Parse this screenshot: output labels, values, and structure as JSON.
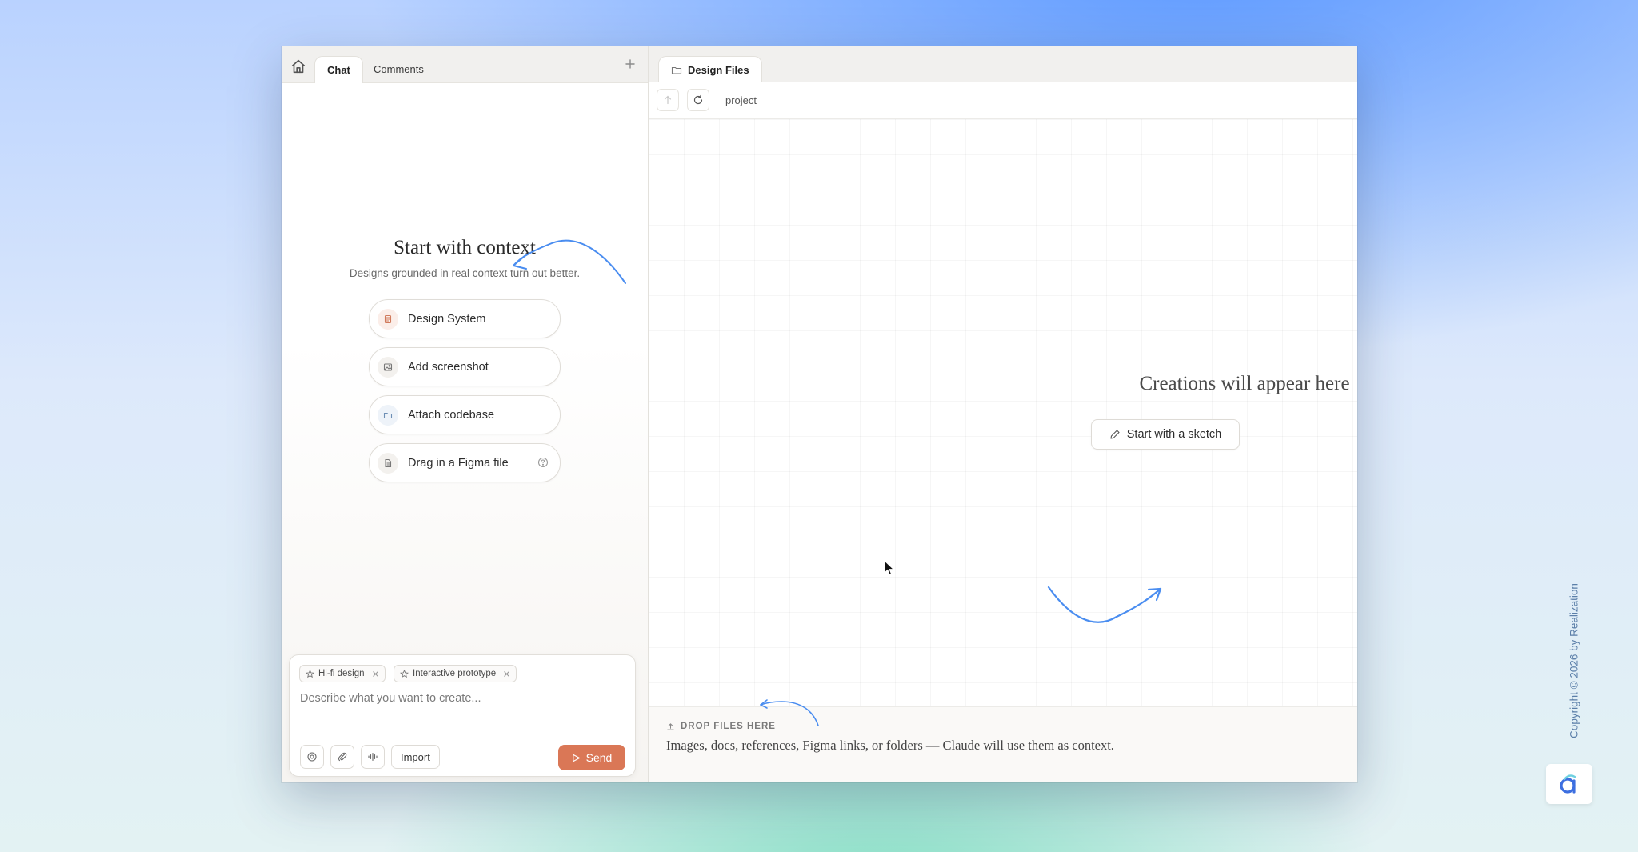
{
  "left_panel": {
    "tabs": [
      {
        "label": "Chat",
        "active": true
      },
      {
        "label": "Comments",
        "active": false
      }
    ],
    "context": {
      "title": "Start with context",
      "subtitle": "Designs grounded in real context turn out better.",
      "options": [
        {
          "label": "Design System",
          "icon": "design-system-icon"
        },
        {
          "label": "Add screenshot",
          "icon": "image-icon"
        },
        {
          "label": "Attach codebase",
          "icon": "folder-icon"
        },
        {
          "label": "Drag in a Figma file",
          "icon": "document-icon",
          "help_icon": "help-icon"
        }
      ]
    },
    "composer": {
      "chips": [
        {
          "label": "Hi-fi design"
        },
        {
          "label": "Interactive prototype"
        }
      ],
      "placeholder": "Describe what you want to create...",
      "import_label": "Import",
      "send_label": "Send"
    }
  },
  "right_panel": {
    "tab_label": "Design Files",
    "breadcrumb": "project",
    "empty_title": "Creations will appear here",
    "sketch_label": "Start with a sketch",
    "drop": {
      "label": "DROP FILES HERE",
      "description": "Images, docs, references, Figma links, or folders — Claude will use them as context."
    }
  },
  "watermark": {
    "copyright": "Copyright © 2026 by Realization"
  },
  "colors": {
    "accent": "#da7756",
    "annotation_arrow": "#4a8df0"
  }
}
